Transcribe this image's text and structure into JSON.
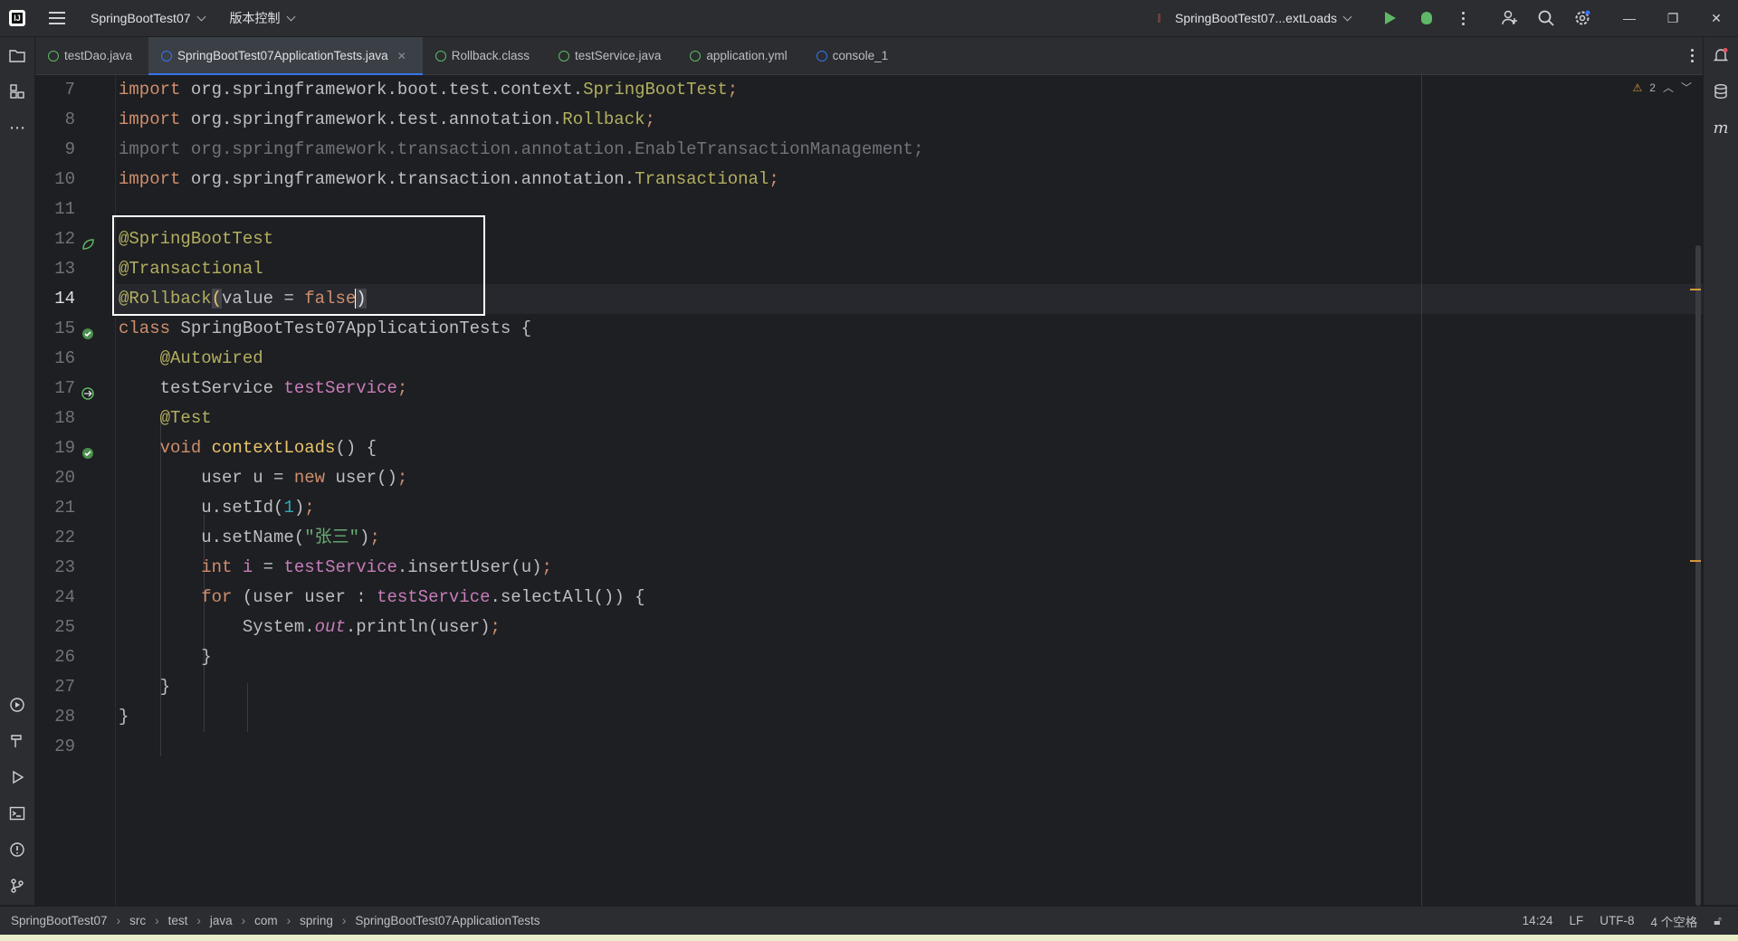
{
  "titlebar": {
    "project": "SpringBootTest07",
    "vcs": "版本控制",
    "run_config": "SpringBootTest07...extLoads"
  },
  "tabs": [
    {
      "label": "testDao.java",
      "icon": "interface-icon"
    },
    {
      "label": "SpringBootTest07ApplicationTests.java",
      "icon": "class-icon",
      "active": true
    },
    {
      "label": "Rollback.class",
      "icon": "annotation-icon"
    },
    {
      "label": "testService.java",
      "icon": "interface-icon"
    },
    {
      "label": "application.yml",
      "icon": "yaml-icon"
    },
    {
      "label": "console_1",
      "icon": "console-icon"
    }
  ],
  "editor": {
    "warnings": "2",
    "current_line": 14,
    "line_numbers": [
      "7",
      "8",
      "9",
      "10",
      "11",
      "12",
      "13",
      "14",
      "15",
      "16",
      "17",
      "18",
      "19",
      "20",
      "21",
      "22",
      "23",
      "24",
      "25",
      "26",
      "27",
      "28",
      "29"
    ]
  },
  "statusbar": {
    "breadcrumbs": [
      "SpringBootTest07",
      "src",
      "test",
      "java",
      "com",
      "spring",
      "SpringBootTest07ApplicationTests"
    ],
    "position": "14:24",
    "line_sep": "LF",
    "encoding": "UTF-8",
    "indent": "4 个空格"
  },
  "colors": {
    "accent": "#3574f0",
    "run_green": "#5fb865",
    "keyword": "#cf8e6d",
    "annotation": "#b3ae60",
    "field": "#c77dbb"
  }
}
